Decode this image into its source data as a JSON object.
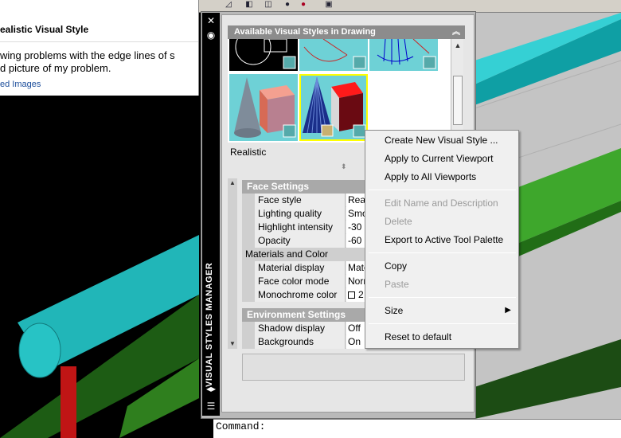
{
  "webpage": {
    "title": "ealistic Visual Style",
    "line1": "wing problems with the edge lines of s",
    "line2": "d picture of my problem.",
    "link": "ed Images"
  },
  "palette": {
    "sidebar_title": "VISUAL STYLES MANAGER",
    "close_glyph": "✕",
    "section_title": "Available Visual Styles in Drawing",
    "collapse_glyph": "︽",
    "current_style_name": "Realistic",
    "thumbnails": [
      "2D Wireframe",
      "3D Hidden",
      "3D Wireframe",
      "Conceptual",
      "Realistic"
    ]
  },
  "properties": {
    "face_settings_title": "Face Settings",
    "face_settings_rows": [
      {
        "label": "Face style",
        "value": "Real"
      },
      {
        "label": "Lighting quality",
        "value": "Smo"
      },
      {
        "label": "Highlight intensity",
        "value": "-30"
      },
      {
        "label": "Opacity",
        "value": "-60"
      }
    ],
    "materials_title": "Materials and Color",
    "materials_rows": [
      {
        "label": "Material display",
        "value": "Mate"
      },
      {
        "label": "Face color mode",
        "value": "Norm"
      },
      {
        "label": "Monochrome color",
        "value": "2"
      }
    ],
    "environment_title": "Environment Settings",
    "environment_rows": [
      {
        "label": "Shadow display",
        "value": "Off"
      },
      {
        "label": "Backgrounds",
        "value": "On"
      }
    ]
  },
  "context_menu": {
    "items": [
      {
        "label": "Create New Visual Style ...",
        "enabled": true
      },
      {
        "label": "Apply to Current Viewport",
        "enabled": true
      },
      {
        "label": "Apply to All Viewports",
        "enabled": true
      },
      {
        "label": "Edit Name and Description",
        "enabled": false
      },
      {
        "label": "Delete",
        "enabled": false
      },
      {
        "label": "Export to Active Tool Palette",
        "enabled": true
      },
      {
        "label": "Copy",
        "enabled": true
      },
      {
        "label": "Paste",
        "enabled": false
      },
      {
        "label": "Size",
        "enabled": true
      },
      {
        "label": "Reset to default",
        "enabled": true
      }
    ],
    "submenu_arrow": "▶"
  },
  "command_line": {
    "prompt": "Command:"
  },
  "colors": {
    "thumbnail_bg": "#6ed1d6",
    "pipe_cyan": "#1fb5b8",
    "beam_green": "#2f8f20",
    "selection_outline": "#ffff00"
  }
}
